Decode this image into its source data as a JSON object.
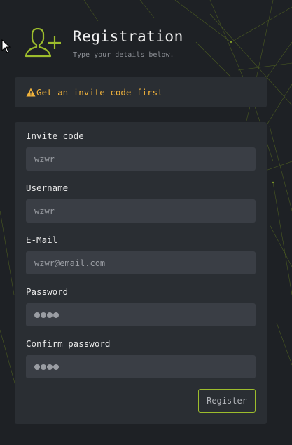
{
  "header": {
    "title": "Registration",
    "subtitle": "Type your details below."
  },
  "alert": {
    "text": "Get an invite code first"
  },
  "form": {
    "fields": [
      {
        "label": "Invite code",
        "value": "wzwr"
      },
      {
        "label": "Username",
        "value": "wzwr"
      },
      {
        "label": "E-Mail",
        "value": "wzwr@email.com"
      },
      {
        "label": "Password",
        "value": "••••",
        "masked": true
      },
      {
        "label": "Confirm password",
        "value": "••••",
        "masked": true
      }
    ],
    "submit_label": "Register"
  },
  "colors": {
    "background": "#1e2125",
    "panel": "#2a2e33",
    "input": "#3a3e45",
    "accent": "#9dbd2c",
    "warning": "#f0b23c"
  }
}
